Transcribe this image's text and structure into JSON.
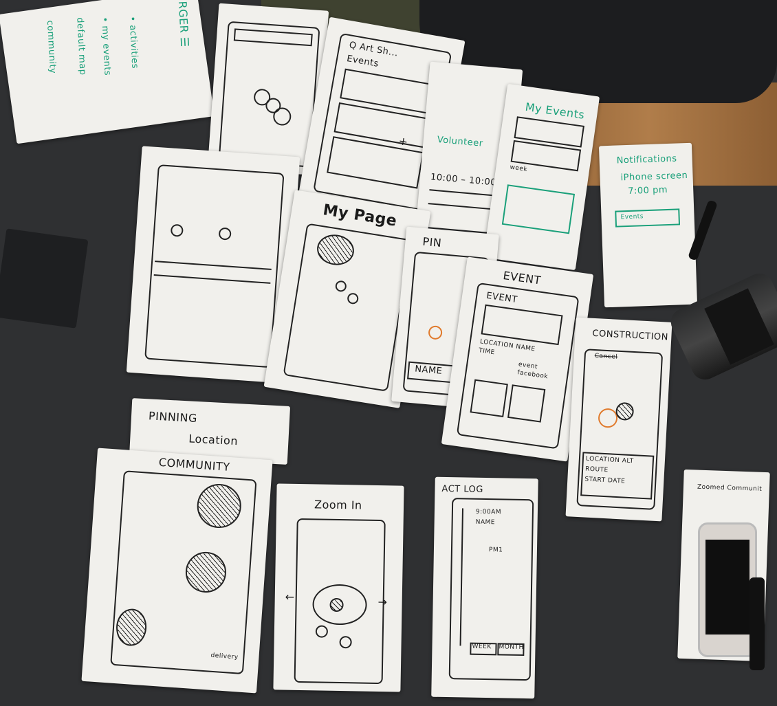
{
  "sketches": {
    "burger": [
      "BURGER ☰",
      "• activities",
      "• my events",
      "default map",
      "community"
    ],
    "search": "Q  Art Sh...",
    "events_tab": "Events",
    "my_events": "My Events",
    "week": "week",
    "volunteer": "Volunteer",
    "time": "10:00 – 10:00",
    "notifications": "Notifications",
    "iphone_screen": "iPhone screen",
    "notif_time": "7:00 pm",
    "events_select": "Events",
    "my_page": "My Page",
    "pin": "PIN",
    "pin_name": "NAME",
    "event_title": "EVENT",
    "event_inner": "EVENT",
    "event_details": [
      "LOCATION NAME",
      "TIME",
      "event",
      "facebook"
    ],
    "construction": "CONSTRUCTION",
    "construction_sub": "Cancel",
    "construction_details": [
      "LOCATION  ALT",
      "ROUTE",
      "START DATE"
    ],
    "pinning_location": [
      "PINNING",
      "Location"
    ],
    "community": "COMMUNITY",
    "community_footer": "delivery",
    "zoom_in": "Zoom In",
    "act_log": "ACT LOG",
    "act_entries": [
      "9:00AM",
      "NAME",
      "PM1"
    ],
    "act_footer": [
      "WEEK",
      "MONTH"
    ],
    "zoomed_community": "Zoomed Communit"
  },
  "colors": {
    "paper": "#f1f0ec",
    "table": "#2f3032",
    "ink": "#1a1a1a",
    "green_marker": "#1aa07a",
    "orange_marker": "#e07a2c"
  }
}
